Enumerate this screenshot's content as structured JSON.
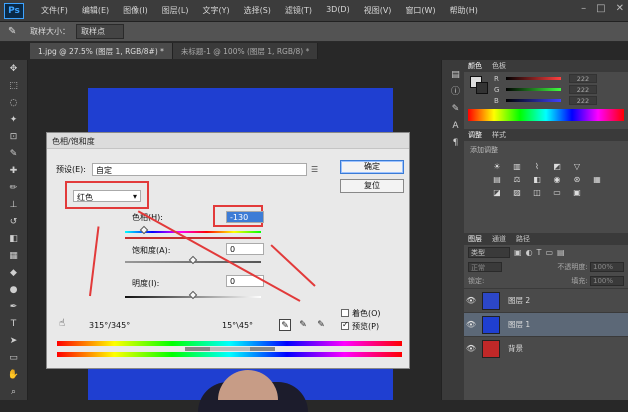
{
  "app": {
    "logo": "Ps"
  },
  "menu": [
    "文件(F)",
    "编辑(E)",
    "图像(I)",
    "图层(L)",
    "文字(Y)",
    "选择(S)",
    "滤镜(T)",
    "3D(D)",
    "视图(V)",
    "窗口(W)",
    "帮助(H)"
  ],
  "options_bar": {
    "label": "取样大小：",
    "value": "取样点"
  },
  "tabs": [
    {
      "label": "1.jpg @ 27.5% (图层 1, RGB/8#) *",
      "active": true
    },
    {
      "label": "未标题-1 @ 100% (图层 1, RGB/8) *",
      "active": false
    }
  ],
  "dialog": {
    "title": "色相/饱和度",
    "preset_label": "预设(E):",
    "preset_value": "自定",
    "ok": "确定",
    "reset": "复位",
    "channel": "红色",
    "hue_label": "色相(H):",
    "hue_value": "-130",
    "saturation_label": "饱和度(A):",
    "saturation_value": "0",
    "lightness_label": "明度(I):",
    "lightness_value": "0",
    "colorize_label": "着色(O)",
    "preview_label": "预览(P)",
    "preview_checked": true,
    "colorize_checked": false,
    "range_left": "315°/345°",
    "range_right": "15°\\45°",
    "hue_level": 0.14,
    "saturation_level": 0.5,
    "lightness_level": 0.5
  },
  "right_panel": {
    "color_tabs": [
      "颜色",
      "色板"
    ],
    "rgb": [
      {
        "channel": "R",
        "value": "222",
        "color": "#ff4040"
      },
      {
        "channel": "G",
        "value": "222",
        "color": "#40ff40"
      },
      {
        "channel": "B",
        "value": "222",
        "color": "#4040ff"
      }
    ],
    "adjust_tabs": [
      "调整",
      "样式"
    ],
    "adjust_title": "添加调整",
    "layers_tabs": [
      "图层",
      "通道",
      "路径"
    ],
    "kind": "类型",
    "blend_mode": "正常",
    "opacity_label": "不透明度:",
    "opacity_value": "100%",
    "lock_label": "锁定:",
    "fill_label": "填充:",
    "fill_value": "100%",
    "layers": [
      {
        "name": "图层 2",
        "selected": false,
        "thumb": "#2c47c8"
      },
      {
        "name": "图层 1",
        "selected": true,
        "thumb": "#1f3fd1"
      },
      {
        "name": "背景",
        "selected": false,
        "thumb": "#c02828"
      }
    ]
  }
}
